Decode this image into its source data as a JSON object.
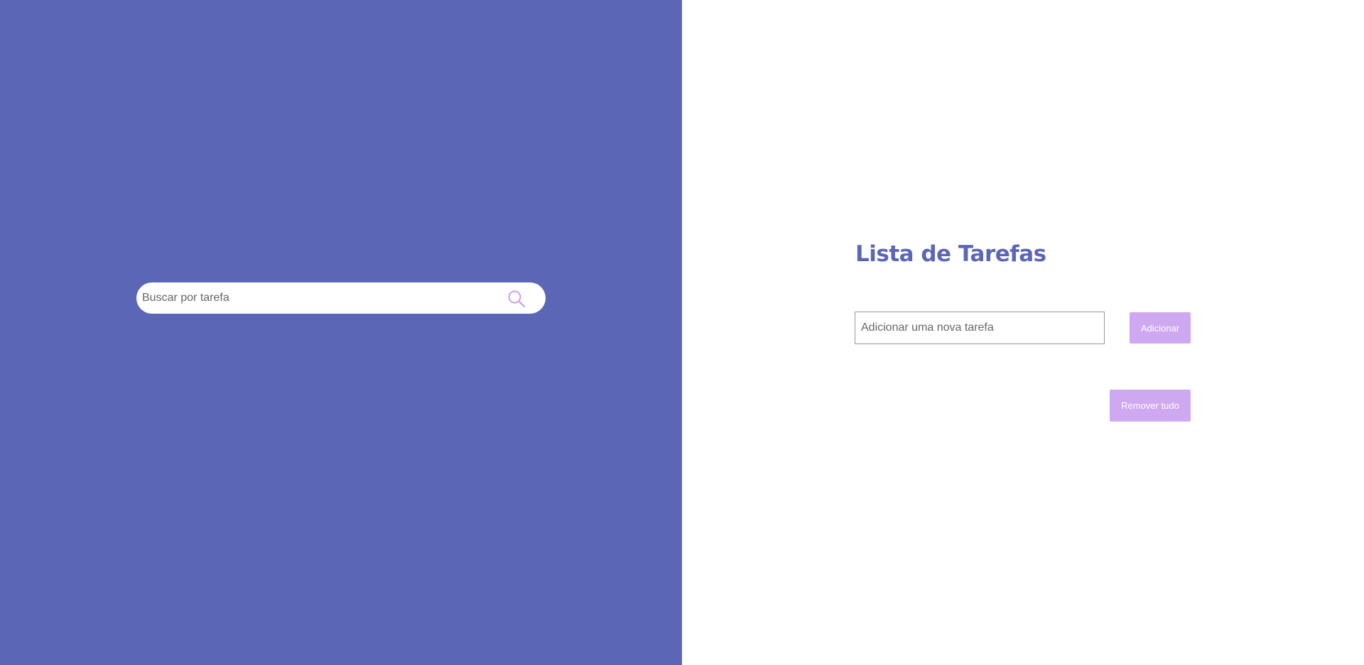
{
  "search": {
    "placeholder": "Buscar por tarefa",
    "icon": "search-icon"
  },
  "main": {
    "title": "Lista de Tarefas",
    "task_input_placeholder": "Adicionar uma nova tarefa",
    "add_label": "Adicionar",
    "remove_all_label": "Remover tudo"
  },
  "colors": {
    "left_panel_bg": "#5c66b6",
    "title": "#5c66b6",
    "button_bg": "#cfa8f2",
    "search_icon": "#c9a0f0"
  }
}
